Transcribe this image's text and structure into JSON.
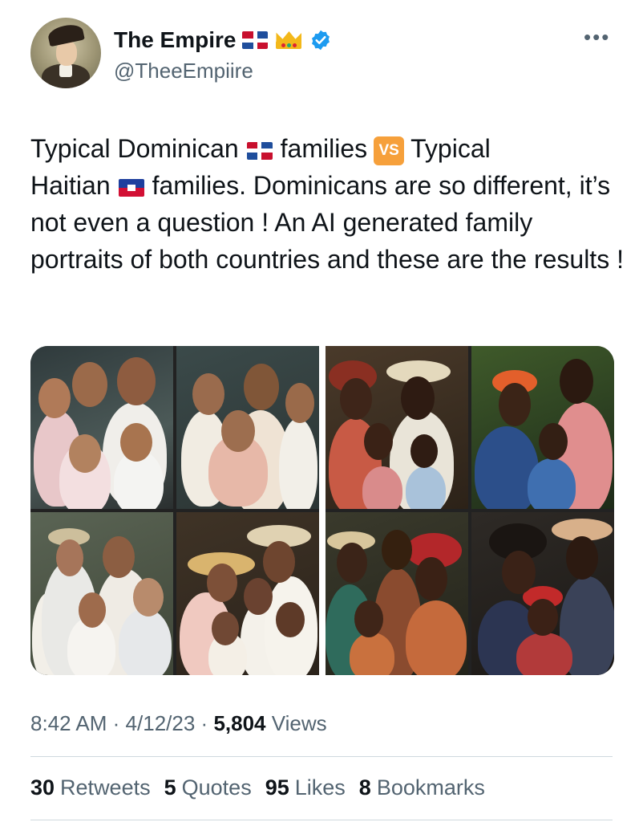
{
  "author": {
    "display_name": "The Empire",
    "handle": "@TheeEmpiire",
    "avatar": "portrait-avatar",
    "badges": [
      "dominican-flag-icon",
      "crown-icon",
      "verified-icon"
    ]
  },
  "more_icon": "more-options-icon",
  "tweet": {
    "seg1": "Typical Dominican",
    "seg2": "families",
    "vs_label": "VS",
    "seg3": "Typical",
    "seg4": "Haitian",
    "seg5": "families. Dominicans are so different, it’s not even a question ! An AI generated family portraits of both countries and these are the results !"
  },
  "media": {
    "images": [
      "dominican-family-portraits-collage",
      "haitian-family-portraits-collage"
    ]
  },
  "meta": {
    "time": "8:42 AM",
    "sep1": "·",
    "date": "4/12/23",
    "sep2": "·",
    "views_count": "5,804",
    "views_label": "Views"
  },
  "stats": [
    {
      "count": "30",
      "label": "Retweets"
    },
    {
      "count": "5",
      "label": "Quotes"
    },
    {
      "count": "95",
      "label": "Likes"
    },
    {
      "count": "8",
      "label": "Bookmarks"
    }
  ],
  "colors": {
    "text": "#0f1419",
    "secondary": "#536471",
    "verified": "#1d9bf0",
    "divider": "#cfd9de",
    "vs_badge": "#f6a03b"
  }
}
